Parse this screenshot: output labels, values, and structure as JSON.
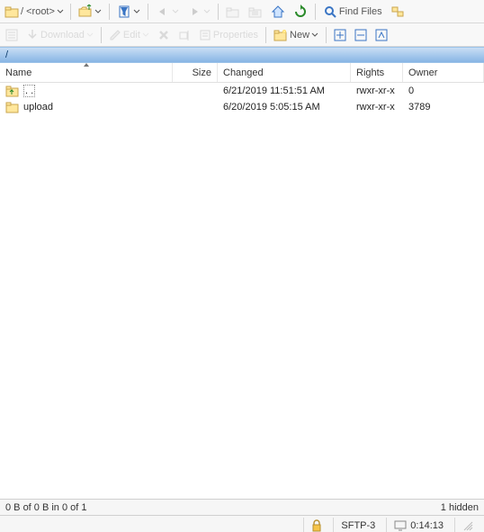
{
  "toolbar1": {
    "path_label": "/ <root>",
    "find_label": "Find Files"
  },
  "toolbar2": {
    "download_label": "Download",
    "edit_label": "Edit",
    "properties_label": "Properties",
    "new_label": "New"
  },
  "breadcrumb": "/",
  "columns": {
    "name": "Name",
    "size": "Size",
    "changed": "Changed",
    "rights": "Rights",
    "owner": "Owner"
  },
  "rows": [
    {
      "name": "..",
      "icon": "parent",
      "size": "",
      "changed": "6/21/2019 11:51:51 AM",
      "rights": "rwxr-xr-x",
      "owner": "0"
    },
    {
      "name": "upload",
      "icon": "folder",
      "size": "",
      "changed": "6/20/2019 5:05:15 AM",
      "rights": "rwxr-xr-x",
      "owner": "3789"
    }
  ],
  "status": {
    "selection": "0 B of 0 B in 0 of 1",
    "hidden": "1 hidden"
  },
  "connection": {
    "protocol": "SFTP-3",
    "elapsed": "0:14:13"
  }
}
